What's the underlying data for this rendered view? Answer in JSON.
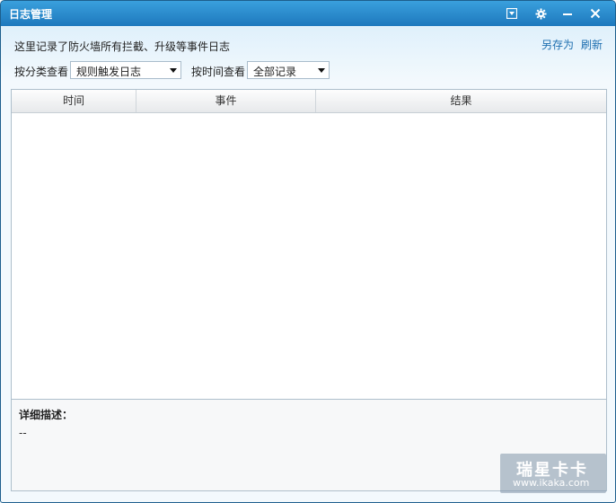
{
  "window": {
    "title": "日志管理",
    "accent": "#1e78bd"
  },
  "header": {
    "description": "这里记录了防火墙所有拦截、升级等事件日志",
    "save_as_label": "另存为",
    "refresh_label": "刷新"
  },
  "filters": {
    "category_label": "按分类查看",
    "category_value": "规则触发日志",
    "time_label": "按时间查看",
    "time_value": "全部记录"
  },
  "table": {
    "columns": [
      "时间",
      "事件",
      "结果"
    ],
    "rows": []
  },
  "detail": {
    "label": "详细描述：",
    "value": "--"
  },
  "watermark": {
    "line1": "瑞星卡卡",
    "line2": "www.ikaka.com"
  }
}
